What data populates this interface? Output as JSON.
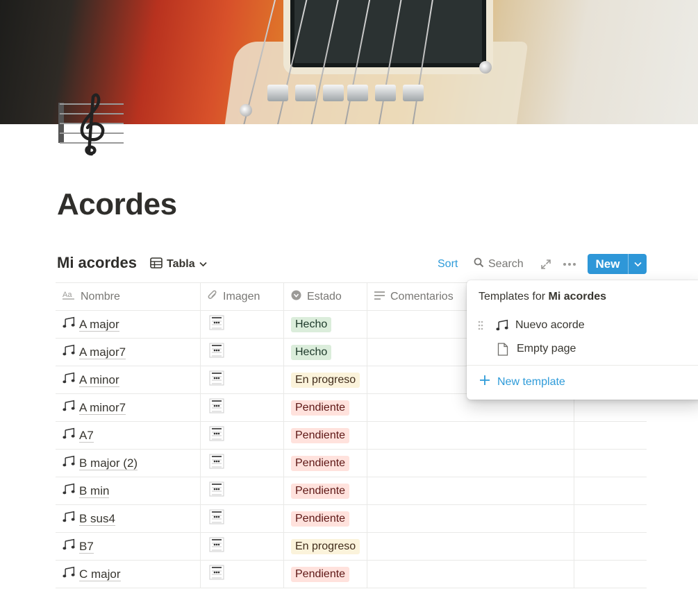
{
  "page": {
    "title": "Acordes",
    "icon": "treble-clef-icon"
  },
  "database": {
    "title": "Mi acordes",
    "view_label": "Tabla",
    "toolbar": {
      "sort": "Sort",
      "search": "Search",
      "new": "New"
    },
    "columns": [
      "Nombre",
      "Imagen",
      "Estado",
      "Comentarios"
    ],
    "rows": [
      {
        "name": "A major",
        "status": "Hecho"
      },
      {
        "name": "A major7",
        "status": "Hecho"
      },
      {
        "name": "A minor",
        "status": "En progreso"
      },
      {
        "name": "A minor7",
        "status": "Pendiente"
      },
      {
        "name": "A7",
        "status": "Pendiente"
      },
      {
        "name": "B major (2)",
        "status": "Pendiente"
      },
      {
        "name": "B min",
        "status": "Pendiente"
      },
      {
        "name": "B sus4",
        "status": "Pendiente"
      },
      {
        "name": "B7",
        "status": "En progreso"
      },
      {
        "name": "C major",
        "status": "Pendiente"
      }
    ]
  },
  "templates_popup": {
    "title_prefix": "Templates for ",
    "title_db": "Mi acordes",
    "items": [
      "Nuevo acorde",
      "Empty page"
    ],
    "new_template": "New template"
  },
  "status_colors": {
    "Hecho": "#dbeddb",
    "En progreso": "#fbf3db",
    "Pendiente": "#ffe2dd"
  },
  "accent_color": "#2e97d8"
}
